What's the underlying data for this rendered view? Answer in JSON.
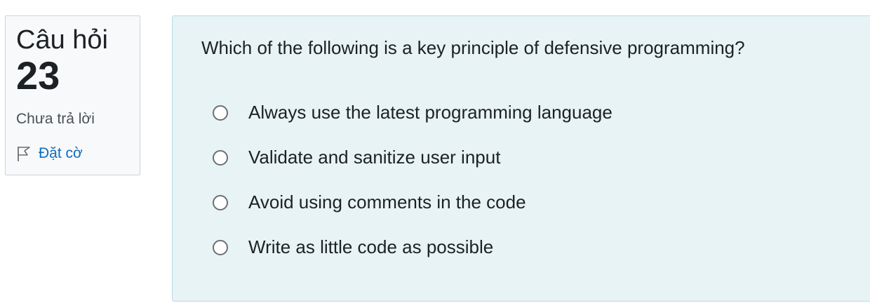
{
  "info": {
    "question_label": "Câu hỏi",
    "question_number": "23",
    "status": "Chưa trả lời",
    "flag_label": "Đặt cờ",
    "flag_icon": "flag-outline-icon"
  },
  "question": {
    "text": "Which of the following is a key principle of defensive programming?",
    "options": [
      {
        "label": "Always use the latest programming language",
        "selected": false
      },
      {
        "label": "Validate and sanitize user input",
        "selected": false
      },
      {
        "label": "Avoid using comments in the code",
        "selected": false
      },
      {
        "label": "Write as little code as possible",
        "selected": false
      }
    ]
  },
  "colors": {
    "content_background": "#e7f3f5",
    "link": "#0f6cbf",
    "info_background": "#f8f9fa"
  }
}
